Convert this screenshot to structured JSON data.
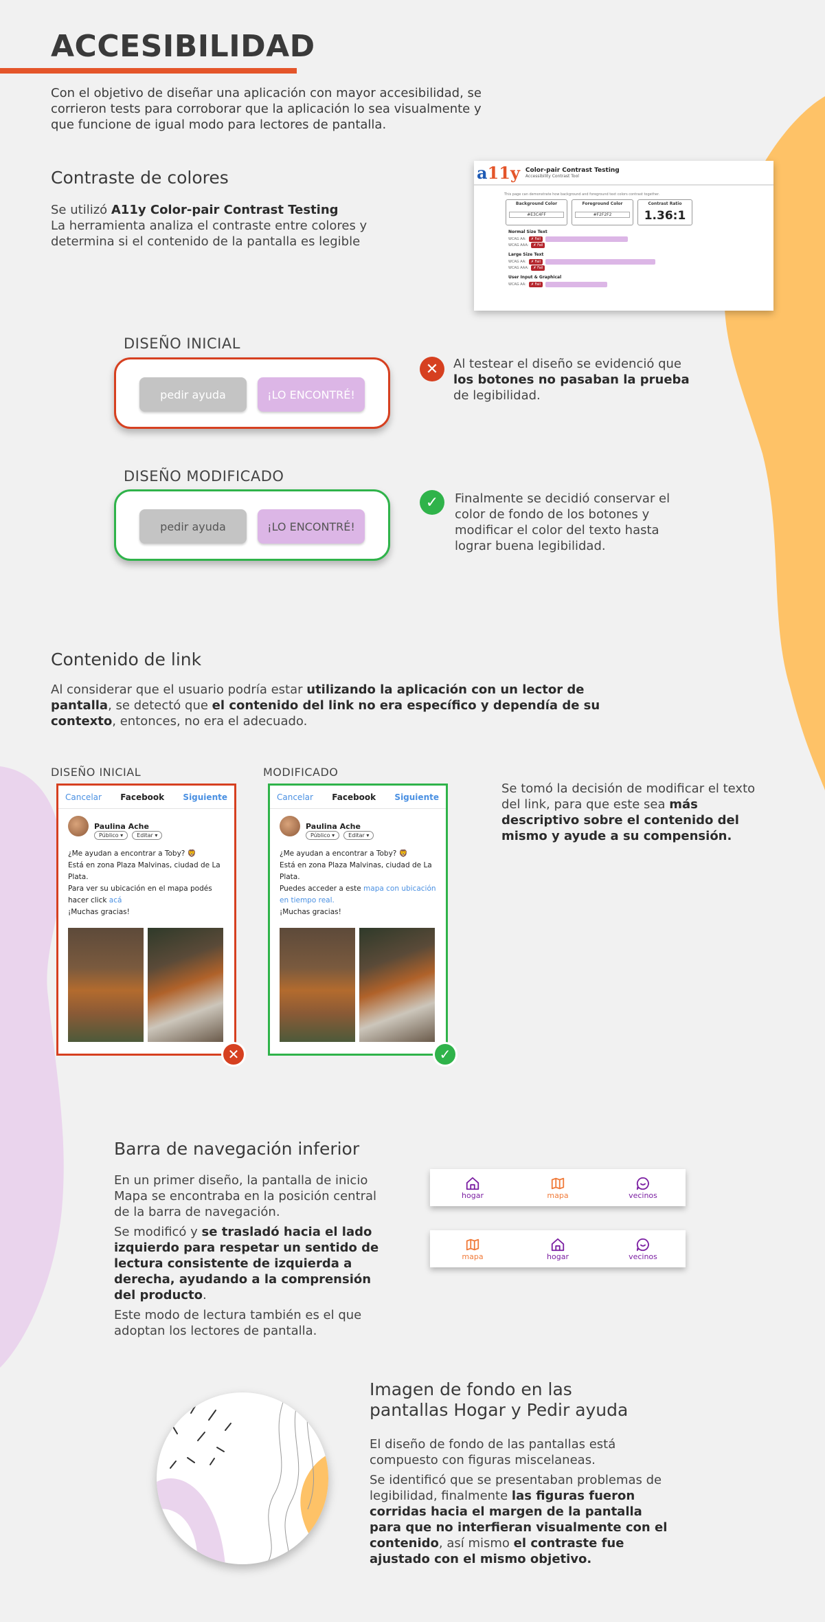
{
  "header": {
    "title": "ACCESIBILIDAD",
    "intro": "Con el objetivo de diseñar una aplicación con mayor accesibilidad, se corrieron tests para corroborar que la aplicación lo sea visualmente y que funcione de igual modo para lectores de pantalla."
  },
  "colors": {
    "accent": "#e4552a",
    "error": "#d64020",
    "success": "#2fb34a",
    "pink": "#dcb6e6",
    "yellow": "#fec267",
    "lavender": "#ead4ed"
  },
  "contrast": {
    "heading": "Contraste de colores",
    "p1_prefix": "Se utilizó ",
    "p1_bold": "A11y Color-pair Contrast Testing",
    "p2": "La herramienta analiza el contraste entre colores y determina si el contenido de la pantalla es legible",
    "tool": {
      "logo_a": "a",
      "logo_11y": "11y",
      "title": "Color-pair Contrast Testing",
      "subtitle": "Accessibility Contrast Tool",
      "note": "This page can demonstrate how background and foreground text colors contrast together.",
      "bg_label": "Background Color",
      "bg_value": "#E3C4FF",
      "fg_label": "Foreground Color",
      "fg_value": "#F2F2F2",
      "ratio_label": "Contrast Ratio",
      "ratio_value": "1.36:1",
      "normal_text": "Normal Size Text",
      "large_text": "Large Size Text",
      "user_input": "User Input & Graphical",
      "fail_label": "✗ Fail",
      "wcag_aa": "WCAG AA:",
      "wcag_aaa": "WCAG AAA:"
    }
  },
  "buttons_demo": {
    "initial_label": "DISEÑO INICIAL",
    "modified_label": "DISEÑO MODIFICADO",
    "help_label": "pedir ayuda",
    "found_label": "¡LO ENCONTRÉ!",
    "fail_note_prefix": "Al testear el diseño se evidenció que ",
    "fail_note_bold": "los botones no pasaban la prueba",
    "fail_note_suffix": " de legibilidad.",
    "success_note": "Finalmente se decidió conservar el color de fondo de los botones y modificar el color del texto hasta lograr buena legibilidad."
  },
  "link_content": {
    "heading": "Contenido de link",
    "p_1": "Al considerar que el usuario podría estar ",
    "p_2": "utilizando la aplicación con un lector de pantalla",
    "p_3": ", se detectó que ",
    "p_4": "el contenido del link no era específico y dependía de su contexto",
    "p_5": ", entonces, no era el adecuado.",
    "initial_label": "DISEÑO INICIAL",
    "modified_label": "MODIFICADO",
    "side_prefix": "Se tomó la decisión de modificar el texto del link, para que este sea ",
    "side_bold": "más descriptivo sobre el contenido del mismo y ayude a su compensión."
  },
  "phone_post": {
    "cancel": "Cancelar",
    "app": "Facebook",
    "next": "Siguiente",
    "user": "Paulina Ache",
    "audience": "Público ▾",
    "edit": "Editar ▾",
    "line1": "¿Me ayudan a encontrar a Toby? 🦁",
    "line2": "Está en zona Plaza Malvinas, ciudad de La Plata.",
    "old_line3": "Para ver su ubicación en el mapa podés hacer click ",
    "old_link": "acá",
    "new_line3": "Puedes acceder a este ",
    "new_link": "mapa con ubicación en tiempo real.",
    "thanks": "¡Muchas gracias!"
  },
  "navigation": {
    "heading": "Barra de navegación inferior",
    "p1": "En un primer diseño, la pantalla de inicio Mapa se encontraba en la posición central de la barra de navegación.",
    "p2_prefix": "Se modificó y ",
    "p2_bold1": "se trasladó hacia el lado izquierdo para respetar un sentido de lectura consistente de izquierda a derecha, ayudando a la comprensión del producto",
    "p2_suffix": ".",
    "p3": "Este modo de lectura también es el que adoptan los lectores de pantalla.",
    "bar1": [
      "hogar",
      "mapa",
      "vecinos"
    ],
    "bar2": [
      "mapa",
      "hogar",
      "vecinos"
    ]
  },
  "background": {
    "heading": "Imagen de fondo en las pantallas Hogar y Pedir ayuda",
    "p1": "El diseño de fondo de las pantallas está compuesto con figuras miscelaneas.",
    "p2_a": "Se identificó que se presentaban problemas de legibilidad, finalmente ",
    "p2_b": "las figuras fueron corridas hacia el margen de la pantalla para que no interfieran visualmente con el contenido",
    "p2_c": ", así mismo ",
    "p2_d": "el contraste fue ajustado con el mismo objetivo."
  }
}
